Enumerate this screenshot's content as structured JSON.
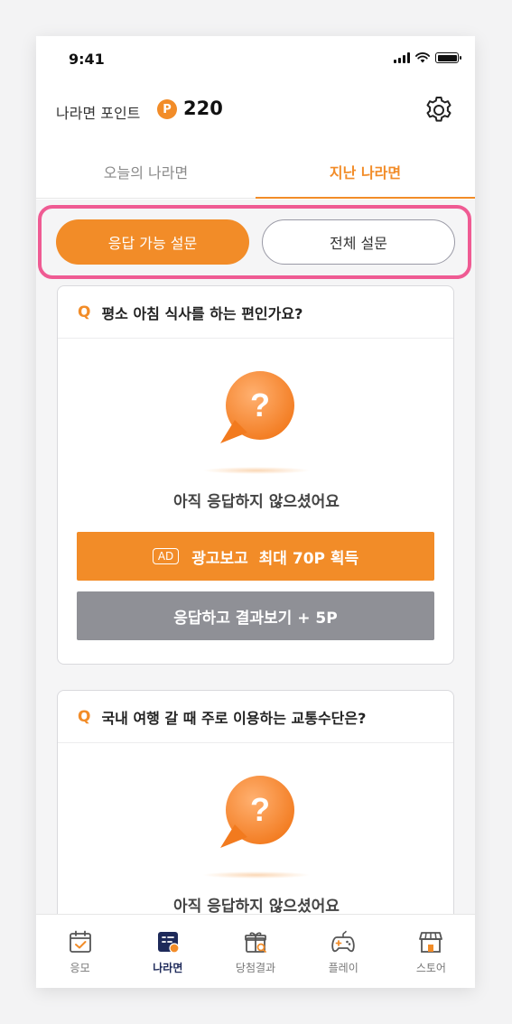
{
  "status_bar": {
    "time": "9:41"
  },
  "header": {
    "points_label": "나라면 포인트",
    "points_badge": "P",
    "points_value": "220"
  },
  "tabs": [
    {
      "label": "오늘의 나라면",
      "active": false
    },
    {
      "label": "지난 나라면",
      "active": true
    }
  ],
  "filters": {
    "primary": "응답 가능 설문",
    "secondary": "전체 설문"
  },
  "cards": [
    {
      "q_mark": "Q",
      "question": "평소 아침 식사를 하는 편인가요?",
      "bubble_mark": "?",
      "status": "아직 응답하지 않으셨어요",
      "ad_tag": "AD",
      "ad_label": "광고보고  최대 70P 획득",
      "result_label": "응답하고 결과보기 + 5P"
    },
    {
      "q_mark": "Q",
      "question": "국내 여행 갈 때 주로 이용하는 교통수단은?",
      "bubble_mark": "?",
      "status": "아직 응답하지 않으셨어요"
    }
  ],
  "bottom_nav": [
    {
      "label": "응모",
      "icon": "calendar-check-icon",
      "active": false
    },
    {
      "label": "나라면",
      "icon": "survey-list-icon",
      "active": true
    },
    {
      "label": "당첨결과",
      "icon": "gift-search-icon",
      "active": false
    },
    {
      "label": "플레이",
      "icon": "gamepad-icon",
      "active": false
    },
    {
      "label": "스토어",
      "icon": "store-icon",
      "active": false
    }
  ],
  "colors": {
    "accent": "#f28c28",
    "highlight": "#ef5b93",
    "nav_active": "#1e2a5a",
    "button_gray": "#8f9096"
  }
}
